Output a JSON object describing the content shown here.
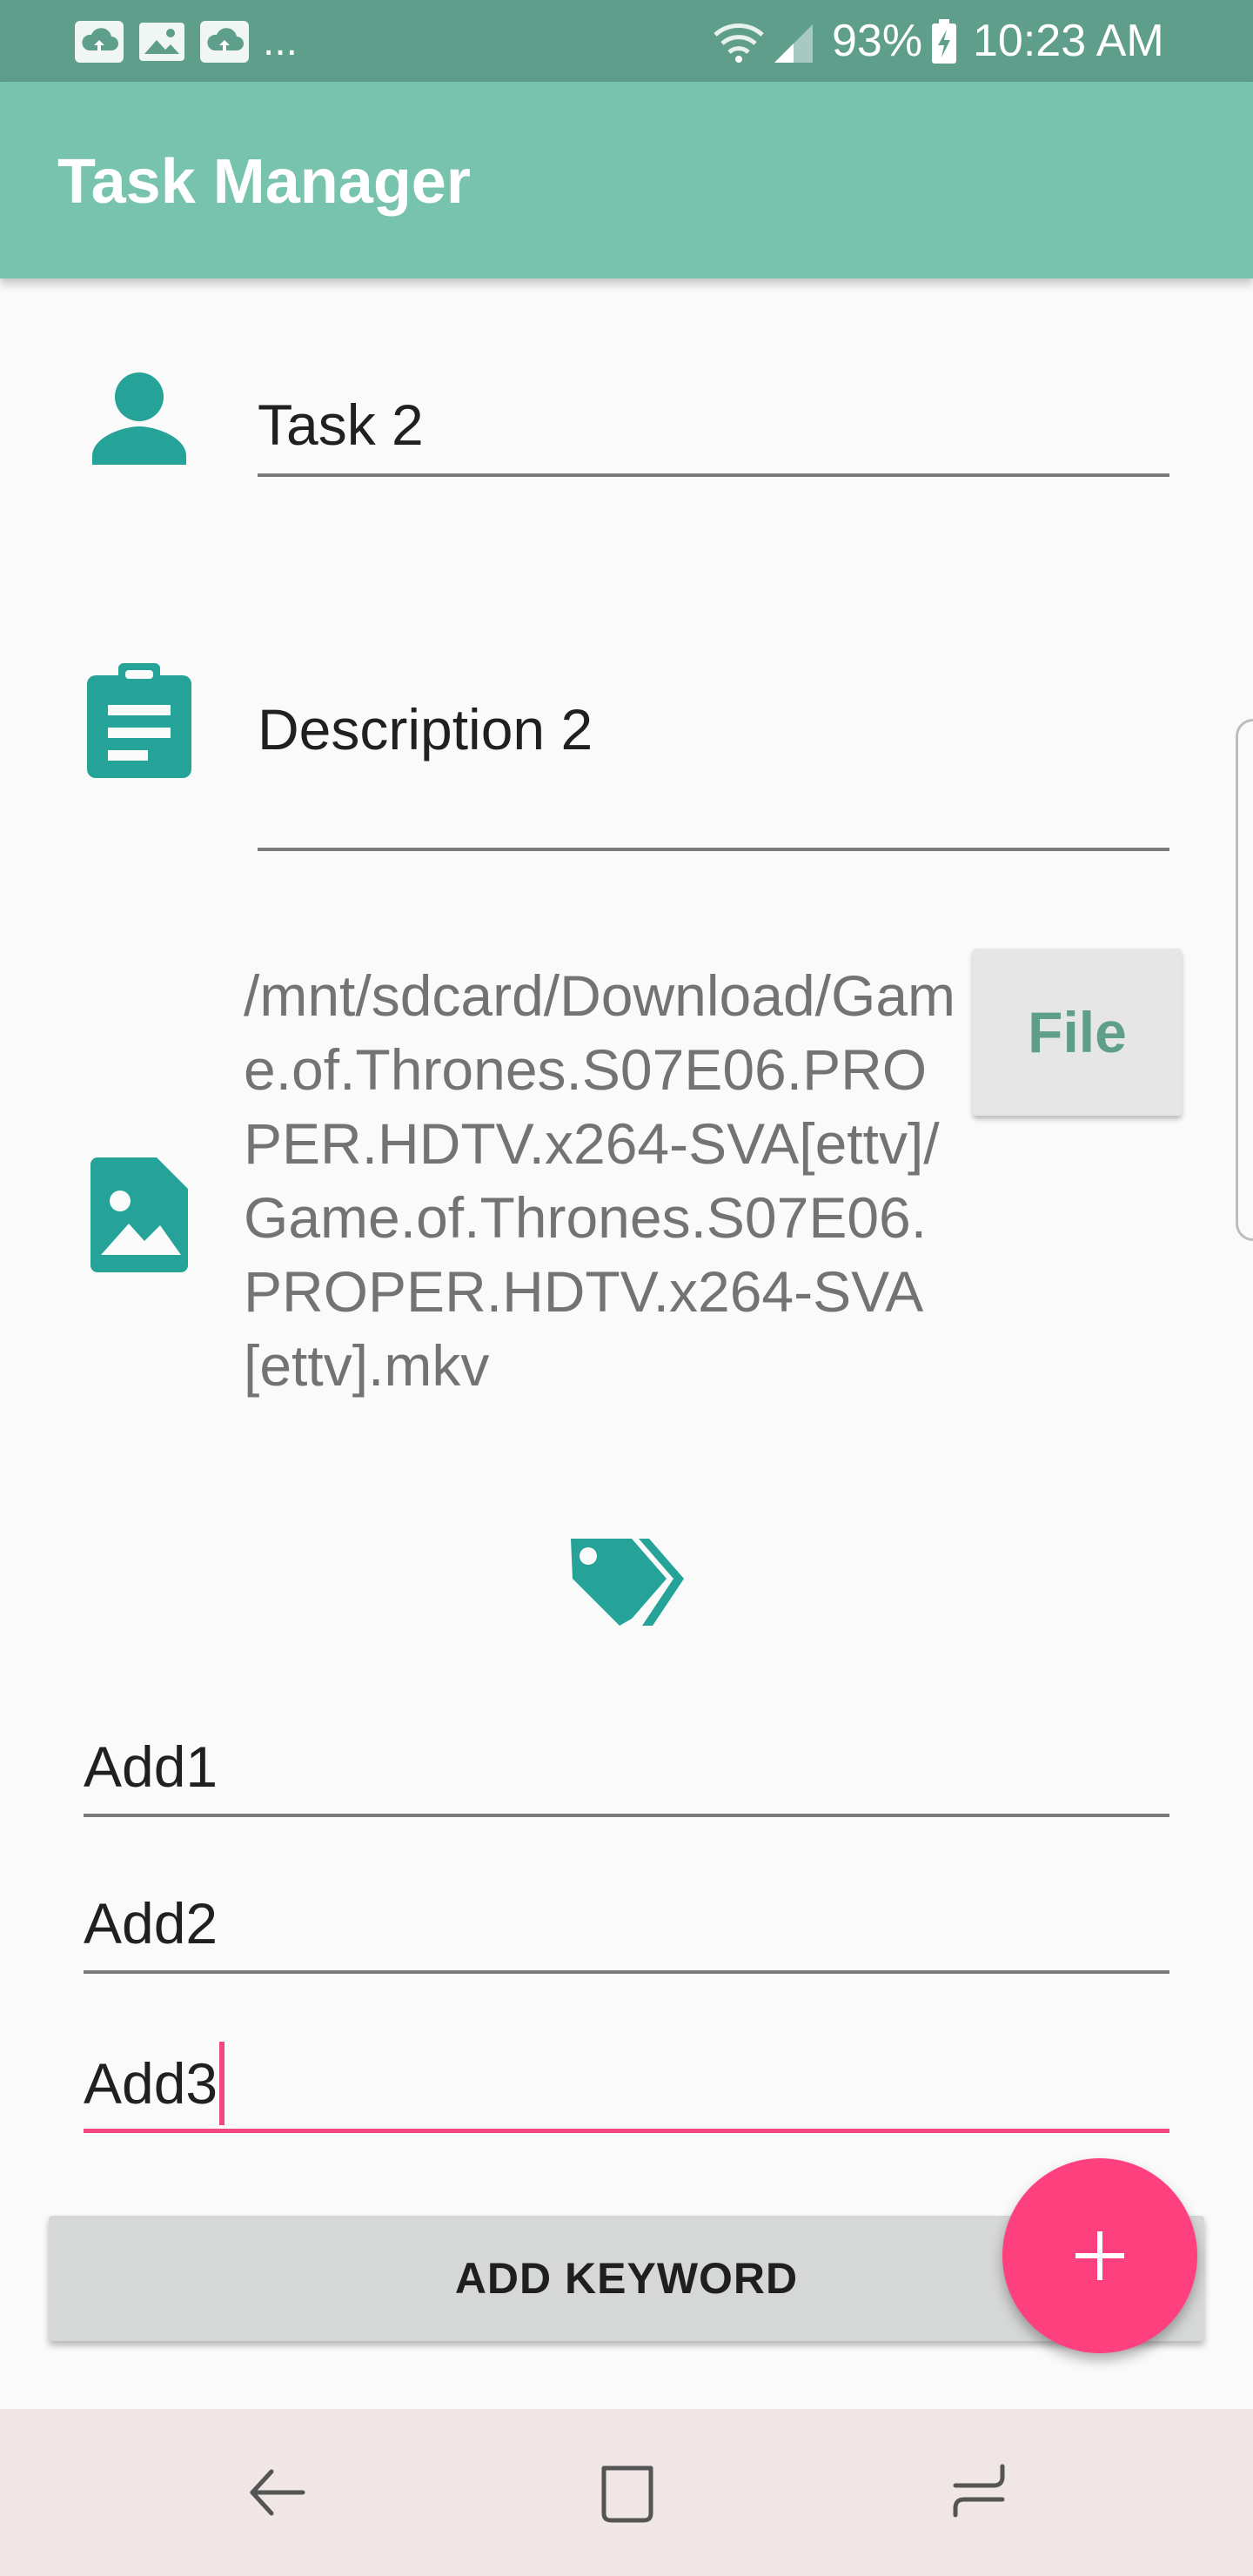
{
  "status_bar": {
    "battery": "93%",
    "time": "10:23 AM",
    "overflow": "..."
  },
  "app_bar": {
    "title": "Task Manager"
  },
  "form": {
    "task_name": "Task 2",
    "description": "Description 2",
    "file_path": "/mnt/sdcard/Download/Game.of.Thrones.S07E06.PROPER.HDTV.x264-SVA[ettv]/Game.of.Thrones.S07E06.PROPER.HDTV.x264-SVA[ettv].mkv",
    "file_button_label": "File"
  },
  "keywords": [
    "Add1",
    "Add2",
    "Add3"
  ],
  "add_keyword_label": "ADD KEYWORD",
  "fab_icon": "plus-icon",
  "colors": {
    "primary": "#78c3ad",
    "primary_dark": "#5e9e8a",
    "icon_teal": "#25a399",
    "accent": "#fe407f"
  }
}
